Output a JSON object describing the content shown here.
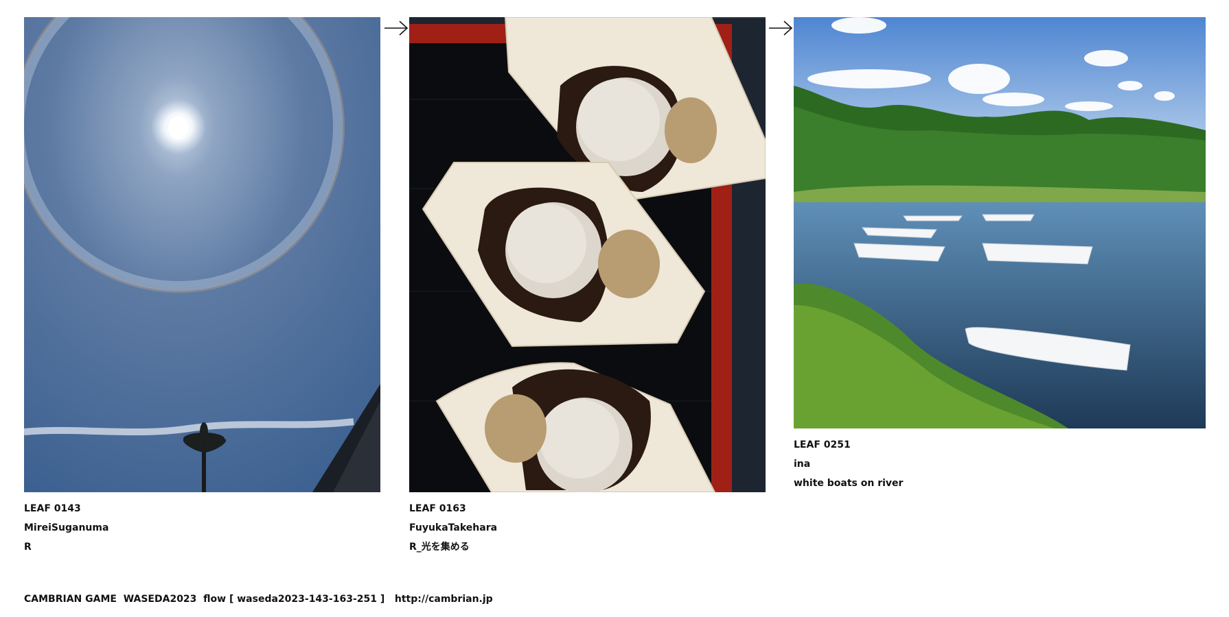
{
  "leaves": [
    {
      "id": "LEAF 0143",
      "author": "MireiSuganuma",
      "title": "R",
      "image": "photo of sun halo in blue sky with palm tree silhouette"
    },
    {
      "id": "LEAF 0163",
      "author": "FuyukaTakehara",
      "title": "R_光を集める",
      "image": "photo of three warabi-mochi desserts on wooden boat plates on a lacquer tray"
    },
    {
      "id": "LEAF 0251",
      "author": "ina",
      "title": "white boats on river",
      "image": "photo of white boats on a river surrounded by green trees"
    }
  ],
  "footer": {
    "text": "CAMBRIAN GAME  WASEDA2023  flow [ waseda2023-143-163-251 ]   ",
    "link": "http://cambrian.jp"
  },
  "icons": [
    "arrow-right-icon",
    "arrow-right-icon"
  ]
}
